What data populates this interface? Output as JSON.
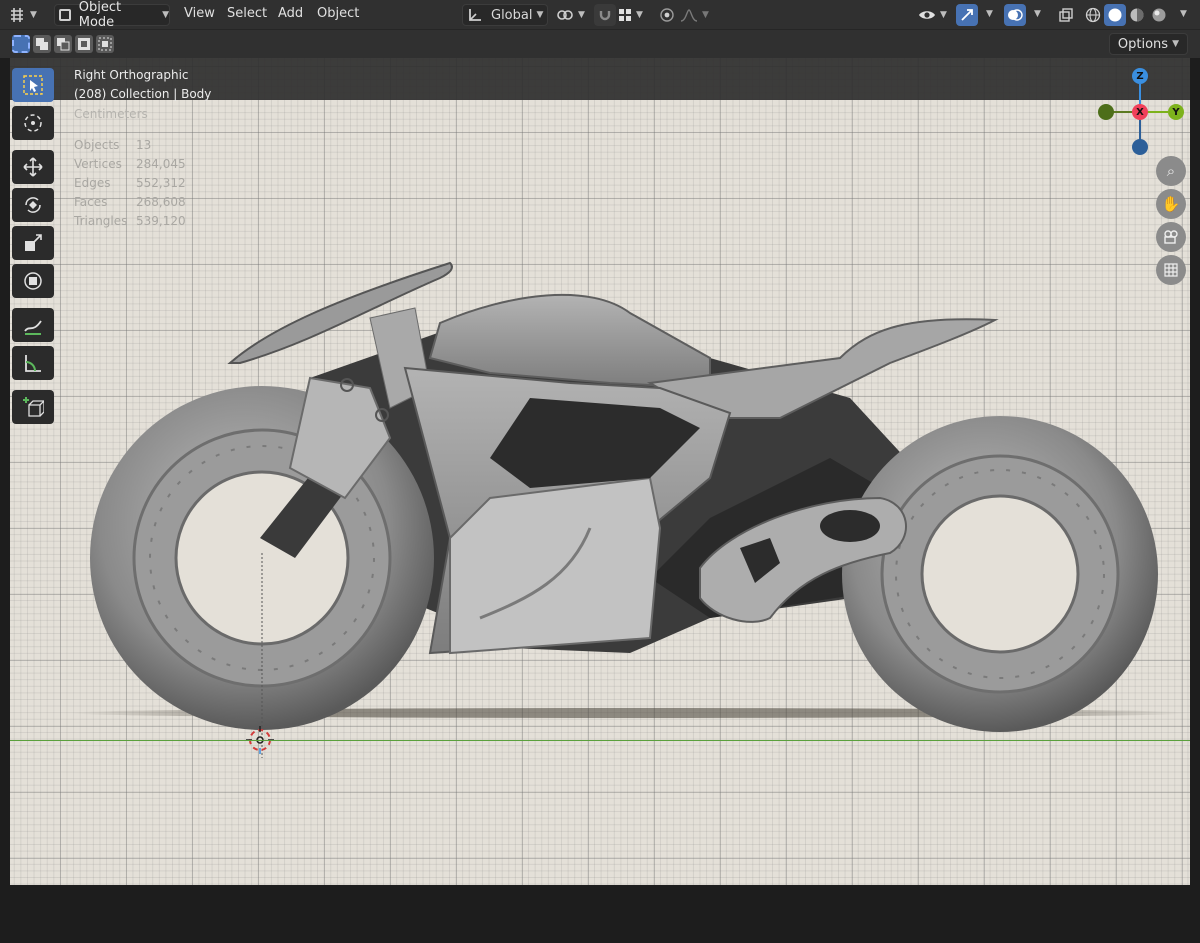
{
  "header": {
    "mode_label": "Object Mode",
    "menus": [
      "View",
      "Select",
      "Add",
      "Object"
    ],
    "transform_orientation": "Global"
  },
  "toolbar_row": {
    "options_label": "Options"
  },
  "viewport": {
    "view_name": "Right Orthographic",
    "collection_path": "(208) Collection | Body",
    "units": "Centimeters",
    "stats": [
      {
        "label": "Objects",
        "value": "13"
      },
      {
        "label": "Vertices",
        "value": "284,045"
      },
      {
        "label": "Edges",
        "value": "552,312"
      },
      {
        "label": "Faces",
        "value": "268,608"
      },
      {
        "label": "Triangles",
        "value": "539,120"
      }
    ]
  },
  "gizmo": {
    "z": "Z",
    "x": "X",
    "y": "Y"
  },
  "icons": {
    "editor_type": "editor-type-icon",
    "mode": "object-mode-icon",
    "select_box": "select-box-icon",
    "cursor": "cursor-icon",
    "move": "move-icon",
    "rotate": "rotate-icon",
    "scale": "scale-icon",
    "transform": "transform-icon",
    "annotate": "annotate-icon",
    "measure": "measure-icon",
    "add_cube": "add-cube-icon",
    "zoom": "zoom-icon",
    "pan": "hand-icon",
    "camera": "camera-icon",
    "grid": "grid-icon"
  },
  "colors": {
    "accent": "#4772b3",
    "axis_x": "#f0405a",
    "axis_y": "#7db21c",
    "axis_z": "#3a8fe0",
    "ground_line": "#5aa03c"
  }
}
